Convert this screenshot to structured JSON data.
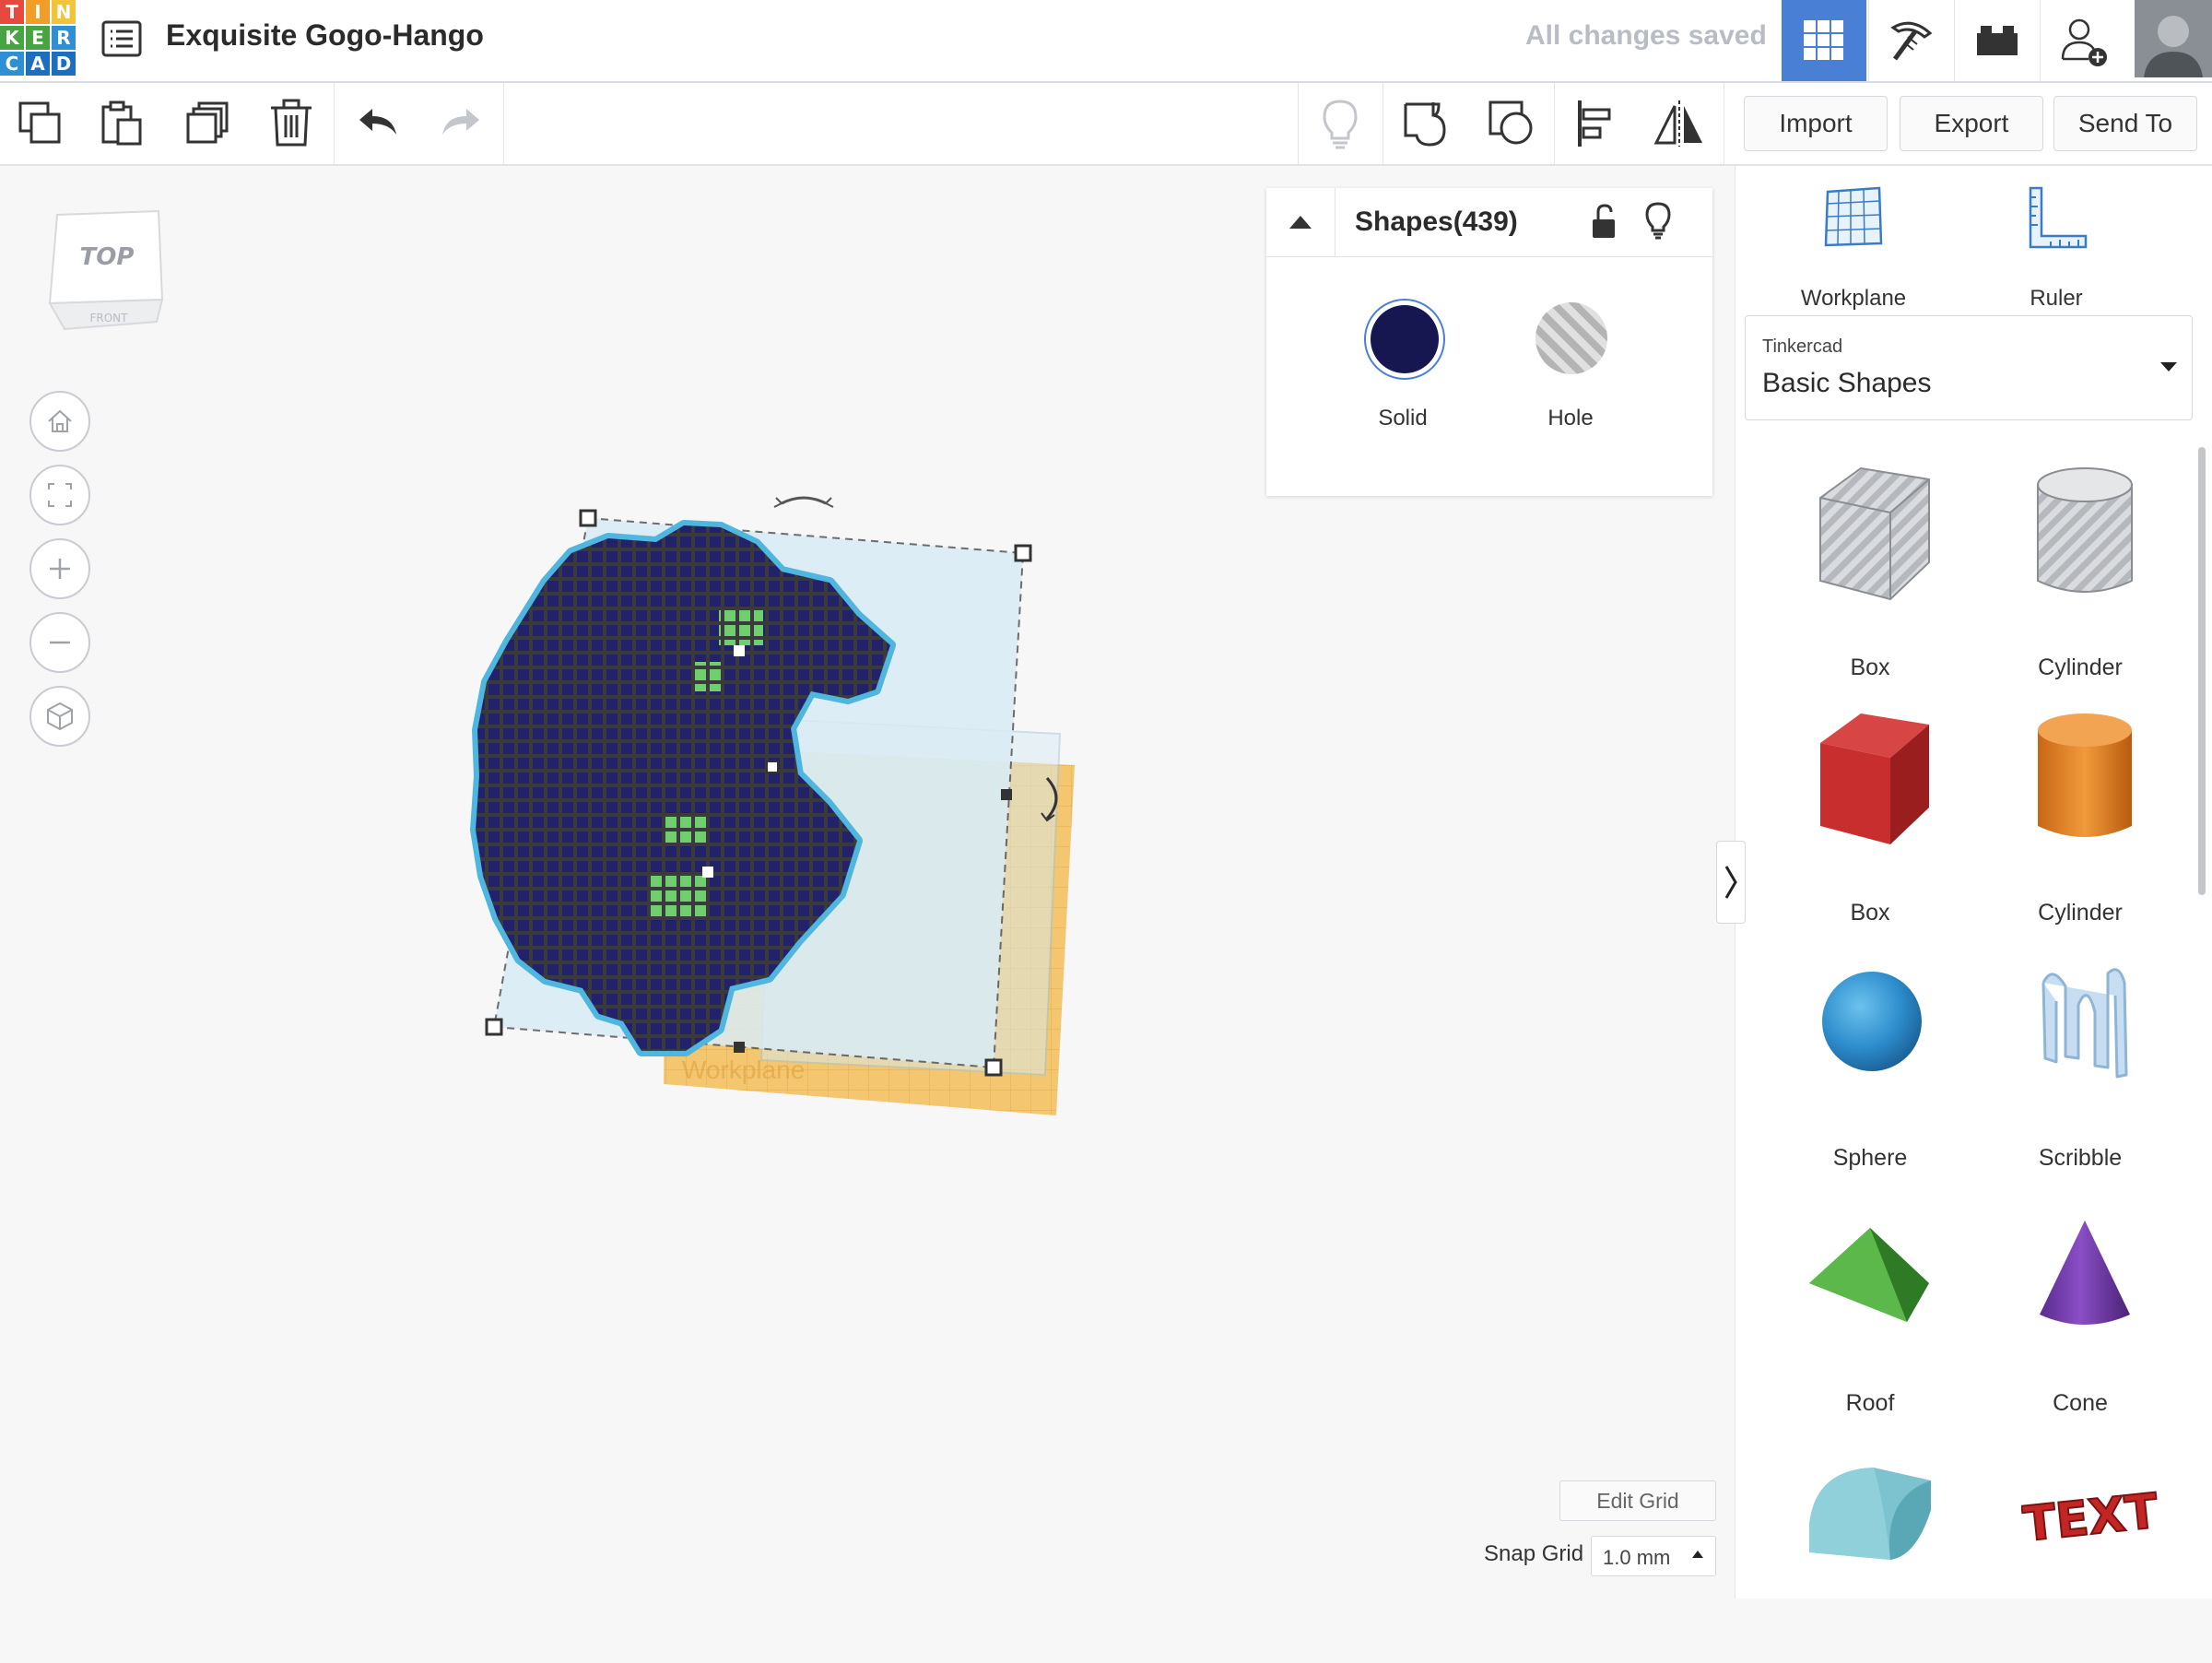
{
  "app": {
    "logo_letters": [
      "T",
      "I",
      "N",
      "K",
      "E",
      "R",
      "C",
      "A",
      "D"
    ],
    "logo_colors": [
      "#e6493d",
      "#f19e29",
      "#f0c43b",
      "#48a443",
      "#48a443",
      "#2e8fd4",
      "#2e8fd4",
      "#1d6fbd",
      "#1d6fbd"
    ],
    "project_title": "Exquisite Gogo-Hango",
    "save_status": "All changes saved",
    "accent_color": "#4a7fd6"
  },
  "header": {
    "icons": [
      "list-icon",
      "grid-view-icon",
      "pickaxe-icon",
      "bricks-icon",
      "add-user-icon"
    ]
  },
  "toolbar": {
    "icons": [
      "copy-icon",
      "paste-icon",
      "duplicate-icon",
      "delete-icon",
      "undo-icon",
      "redo-icon",
      "bulb-icon",
      "group-icon",
      "ungroup-icon",
      "align-icon",
      "mirror-icon"
    ],
    "import_label": "Import",
    "export_label": "Export",
    "send_to_label": "Send To"
  },
  "viewcube": {
    "top_label": "TOP",
    "front_label": "FRONT"
  },
  "canvas": {
    "workplane_label": "Workplane",
    "model_colors": {
      "body": "#1e1e5c",
      "outline": "#3a3a3e",
      "eye": "#6fcf6f",
      "glow": "#4fb6e0",
      "plane": "#f4c66f"
    }
  },
  "inspector": {
    "title": "Shapes(439)",
    "solid_label": "Solid",
    "hole_label": "Hole",
    "solid_color": "#161650"
  },
  "panel": {
    "workplane_label": "Workplane",
    "ruler_label": "Ruler",
    "library_category": "Tinkercad",
    "library_name": "Basic Shapes",
    "shapes": [
      {
        "label": "Box",
        "icon": "box-hole-icon"
      },
      {
        "label": "Cylinder",
        "icon": "cylinder-hole-icon"
      },
      {
        "label": "Box",
        "icon": "box-solid-icon"
      },
      {
        "label": "Cylinder",
        "icon": "cylinder-solid-icon"
      },
      {
        "label": "Sphere",
        "icon": "sphere-icon"
      },
      {
        "label": "Scribble",
        "icon": "scribble-icon"
      },
      {
        "label": "Roof",
        "icon": "roof-icon"
      },
      {
        "label": "Cone",
        "icon": "cone-icon"
      },
      {
        "label": "",
        "icon": "round-roof-icon"
      },
      {
        "label": "",
        "icon": "text-icon"
      }
    ],
    "text_shape_label": "TEXT"
  },
  "grid": {
    "edit_grid_label": "Edit Grid",
    "snap_grid_label": "Snap Grid",
    "snap_value": "1.0 mm"
  }
}
